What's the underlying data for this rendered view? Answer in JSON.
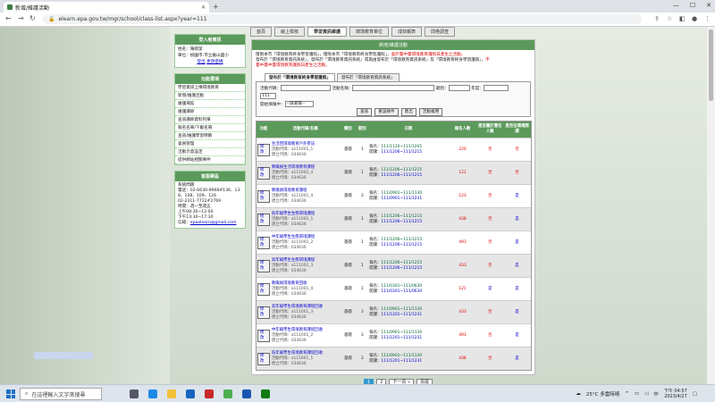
{
  "browser": {
    "tab_title": "新增/維護活動",
    "url": "elearn.epa.gov.tw/mgr/school/class-list.aspx?year=111"
  },
  "topnav": [
    "首頁",
    "線上檢核",
    "學習資訊維護",
    "環境教育單位",
    "成效報表",
    "問卷調查"
  ],
  "login": {
    "title": "登入者資訊",
    "line1": "姓名：陳婉潔",
    "line2": "單位：桃園市-市立龜山國小",
    "logout": "登出",
    "pwd": "更改密碼"
  },
  "func": {
    "title": "功能選項",
    "items": [
      "學習資訊上傳環境教育",
      "新增/維護活動",
      "維護場館",
      "維護講師",
      "查詢講師資料列單",
      "報名名單/下載名冊",
      "查詢/維護學習時數",
      "會員管理",
      "活動示意設定",
      "提供網站相關事件"
    ]
  },
  "contact": {
    "title": "客服專區",
    "l1": "系統問題",
    "l2": "電話：02-6630-9968#136、13",
    "l3": "8、108、109、126",
    "l4": "02-2311-7722#2769",
    "l5": "時間：週一至週五",
    "l6": "上午08:30~12:00",
    "l7": "下午13:30~17:30",
    "l8": "信箱：",
    "email": "epaelearn@gmail.com"
  },
  "main": {
    "title": "新增/維護活動",
    "n1": "僅限本市「環境教育終身學習護照」，僅限本市「環境教育終身學習護照」，",
    "n1r": "會於臺中臺環境教育護照日產生之活動。",
    "n2": "發布於「環境教育資訊系統」，發布於「環境教育資訊系統」或再由發布於「環境教育資訊系統」及「環境教育終身學習護照」，",
    "n2r": "不",
    "n3": "臺中臺中臺環境教育護照日產生之活動。"
  },
  "subtabs": [
    "發布於「環境教育終身學習護照」",
    "發布於「環境教育資訊系統」"
  ],
  "search": {
    "code": "活動代碼：",
    "name": "活動名稱：",
    "period": "期別：",
    "year": "年度：",
    "year_val": "111",
    "status": "開始填報中：",
    "status_val": "--請選擇--",
    "b1": "查詢",
    "b2": "重設條件",
    "b3": "匯出",
    "b4": "活動複用"
  },
  "table": {
    "headers": [
      "功能",
      "活動代碼/名稱",
      "類別",
      "期別",
      "日期",
      "報名人數",
      "是否屬於實名人數",
      "是否在環境開課"
    ],
    "edit": "修改",
    "rows": [
      {
        "name": "生活回環境教育戶外參訪",
        "code": "活動代碼：a111001_1",
        "cname": "建立代碼：034636",
        "type": "基礎",
        "period": "1",
        "signup": "111/1126~111/1205",
        "session": "111/1206~111/1215",
        "count": "220",
        "a": "否",
        "b": "否"
      },
      {
        "name": "教職員生活環境教育課程",
        "code": "活動代碼：a111002_4",
        "cname": "建立代碼：034636",
        "type": "基礎",
        "period": "1",
        "signup": "111/1206~111/1215",
        "session": "111/1206~111/1215",
        "count": "121",
        "a": "否",
        "b": "否"
      },
      {
        "name": "教職員環境教育課程",
        "code": "活動代碼：a111001_4",
        "cname": "建立代碼：034636",
        "type": "基礎",
        "period": "3",
        "signup": "111/0901~111/1130",
        "session": "111/0901~111/1231",
        "count": "123",
        "a": "否",
        "b": "是"
      },
      {
        "name": "低年級學生生態環境課程",
        "code": "活動代碼：a111002_1",
        "cname": "建立代碼：034636",
        "type": "基礎",
        "period": "1",
        "signup": "111/1206~111/1215",
        "session": "111/1206~111/1215",
        "count": "438",
        "a": "否",
        "b": "是"
      },
      {
        "name": "中年級學生生態環境課程",
        "code": "活動代碼：a111002_2",
        "cname": "建立代碼：034636",
        "type": "基礎",
        "period": "1",
        "signup": "111/1206~111/1215",
        "session": "111/1206~111/1215",
        "count": "493",
        "a": "否",
        "b": "是"
      },
      {
        "name": "高年級學生生態環境課程",
        "code": "活動代碼：a111002_3",
        "cname": "建立代碼：034636",
        "type": "基礎",
        "period": "1",
        "signup": "111/1206~111/1215",
        "session": "111/1206~111/1215",
        "count": "433",
        "a": "否",
        "b": "是"
      },
      {
        "name": "教職員環境教育回收",
        "code": "活動代碼：a111001_4",
        "cname": "建立代碼：034636",
        "type": "基礎",
        "period": "1",
        "signup": "111/0301~111/0630",
        "session": "111/0301~111/0630",
        "count": "121",
        "a": "是",
        "b": "是"
      },
      {
        "name": "高年級學生環境教育課程回收",
        "code": "活動代碼：a111001_3",
        "cname": "建立代碼：034636",
        "type": "基礎",
        "period": "3",
        "signup": "111/0901~111/1130",
        "session": "111/1201~111/1231",
        "count": "433",
        "a": "否",
        "b": "是"
      },
      {
        "name": "中年級學生環境教育課程回收",
        "code": "活動代碼：a111001_2",
        "cname": "建立代碼：034636",
        "type": "基礎",
        "period": "3",
        "signup": "111/0901~111/1130",
        "session": "111/1201~111/1231",
        "count": "493",
        "a": "否",
        "b": "是"
      },
      {
        "name": "低年級學生環境教育課程回收",
        "code": "活動代碼：a111001_1",
        "cname": "建立代碼：034636",
        "type": "基礎",
        "period": "3",
        "signup": "111/0901~111/1130",
        "session": "111/1201~111/1231",
        "count": "438",
        "a": "否",
        "b": "是"
      }
    ]
  },
  "pager": {
    "p1": "1",
    "p2": "2",
    "next": "下一頁 »",
    "last": "頁尾"
  },
  "taskbar": {
    "search": "在這裡輸入文字來搜尋",
    "weather": "25°C 多雲時晴",
    "time": "下午 04:57",
    "date": "2023/4/27",
    "lang": "中"
  }
}
